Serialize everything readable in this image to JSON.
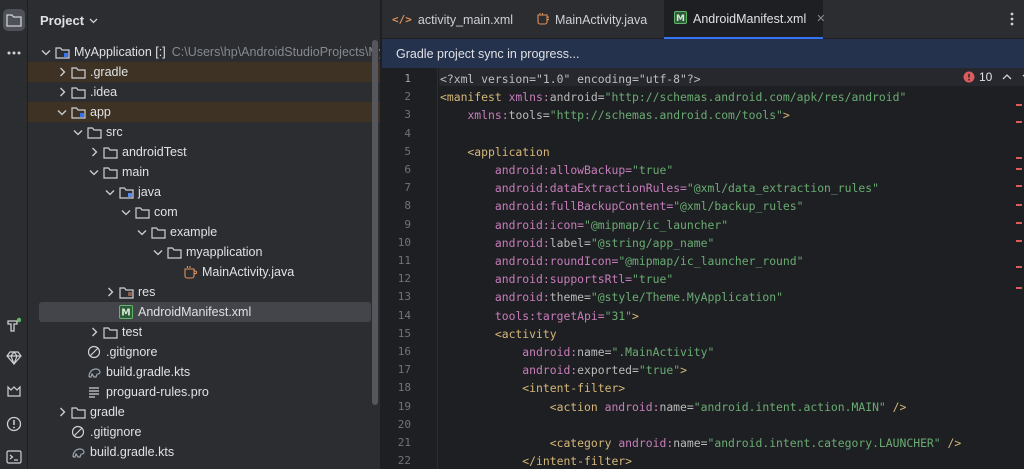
{
  "project_panel": {
    "title": "Project",
    "tree": [
      {
        "label": "MyApplication [:]",
        "hint": "C:\\Users\\hp\\AndroidStudioProjects\\MyAp",
        "depth": 0,
        "expanded": true,
        "icon": "module-folder-icon"
      },
      {
        "label": ".gradle",
        "depth": 1,
        "expanded": false,
        "icon": "folder-icon",
        "excluded": true
      },
      {
        "label": ".idea",
        "depth": 1,
        "expanded": false,
        "icon": "folder-icon"
      },
      {
        "label": "app",
        "depth": 1,
        "expanded": true,
        "icon": "module-folder-icon",
        "excluded": true
      },
      {
        "label": "src",
        "depth": 2,
        "expanded": true,
        "icon": "folder-icon"
      },
      {
        "label": "androidTest",
        "depth": 3,
        "expanded": false,
        "icon": "folder-icon"
      },
      {
        "label": "main",
        "depth": 3,
        "expanded": true,
        "icon": "folder-icon"
      },
      {
        "label": "java",
        "depth": 4,
        "expanded": true,
        "icon": "source-folder-icon"
      },
      {
        "label": "com",
        "depth": 5,
        "expanded": true,
        "icon": "package-icon"
      },
      {
        "label": "example",
        "depth": 6,
        "expanded": true,
        "icon": "package-icon"
      },
      {
        "label": "myapplication",
        "depth": 7,
        "expanded": true,
        "icon": "package-icon"
      },
      {
        "label": "MainActivity.java",
        "depth": 8,
        "icon": "java-class-icon"
      },
      {
        "label": "res",
        "depth": 4,
        "expanded": false,
        "icon": "resource-folder-icon"
      },
      {
        "label": "AndroidManifest.xml",
        "depth": 4,
        "icon": "manifest-icon",
        "selected": true
      },
      {
        "label": "test",
        "depth": 3,
        "expanded": false,
        "icon": "folder-icon"
      },
      {
        "label": ".gitignore",
        "depth": 2,
        "icon": "gitignore-icon"
      },
      {
        "label": "build.gradle.kts",
        "depth": 2,
        "icon": "gradle-file-icon"
      },
      {
        "label": "proguard-rules.pro",
        "depth": 2,
        "icon": "text-file-icon"
      },
      {
        "label": "gradle",
        "depth": 1,
        "expanded": false,
        "icon": "folder-icon"
      },
      {
        "label": ".gitignore",
        "depth": 1,
        "icon": "gitignore-icon"
      },
      {
        "label": "build.gradle.kts",
        "depth": 1,
        "icon": "gradle-file-icon"
      }
    ]
  },
  "editor": {
    "tabs": [
      {
        "label": "activity_main.xml",
        "icon": "xml-icon",
        "active": false
      },
      {
        "label": "MainActivity.java",
        "icon": "java-class-icon",
        "active": false
      },
      {
        "label": "AndroidManifest.xml",
        "icon": "manifest-icon",
        "active": true
      }
    ],
    "tab_close": "✕",
    "banner": "Gradle project sync in progress...",
    "problems_count": "10",
    "lines": [
      {
        "n": "1",
        "parts": [
          [
            "pi",
            "<?xml version=\"1.0\" encoding=\"utf-8\"?>"
          ]
        ]
      },
      {
        "n": "2",
        "parts": [
          [
            "tg",
            "<manifest "
          ],
          [
            "ns",
            "xmlns:"
          ],
          [
            "at",
            "android="
          ],
          [
            "vl",
            "\"http://schemas.android.com/apk/res/android\""
          ]
        ]
      },
      {
        "n": "3",
        "parts": [
          [
            "at",
            "    "
          ],
          [
            "ns",
            "xmlns:"
          ],
          [
            "at",
            "tools="
          ],
          [
            "vl",
            "\"http://schemas.android.com/tools\""
          ],
          [
            "tg",
            ">"
          ]
        ]
      },
      {
        "n": "4",
        "parts": []
      },
      {
        "n": "5",
        "parts": [
          [
            "tg",
            "    <application"
          ]
        ]
      },
      {
        "n": "6",
        "parts": [
          [
            "at",
            "        "
          ],
          [
            "ns",
            "android:"
          ],
          [
            "ns",
            "allowBackup="
          ],
          [
            "vl",
            "\"true\""
          ]
        ]
      },
      {
        "n": "7",
        "parts": [
          [
            "at",
            "        "
          ],
          [
            "ns",
            "android:"
          ],
          [
            "ns",
            "dataExtractionRules="
          ],
          [
            "vl",
            "\"@xml/data_extraction_rules\""
          ]
        ]
      },
      {
        "n": "8",
        "parts": [
          [
            "at",
            "        "
          ],
          [
            "ns",
            "android:"
          ],
          [
            "ns",
            "fullBackupContent="
          ],
          [
            "vl",
            "\"@xml/backup_rules\""
          ]
        ]
      },
      {
        "n": "9",
        "parts": [
          [
            "at",
            "        "
          ],
          [
            "ns",
            "android:"
          ],
          [
            "ns",
            "icon="
          ],
          [
            "vl",
            "\"@mipmap/ic_launcher\""
          ]
        ]
      },
      {
        "n": "10",
        "parts": [
          [
            "at",
            "        "
          ],
          [
            "ns",
            "android:"
          ],
          [
            "at",
            "label="
          ],
          [
            "vl",
            "\"@string/app_name\""
          ]
        ]
      },
      {
        "n": "11",
        "parts": [
          [
            "at",
            "        "
          ],
          [
            "ns",
            "android:"
          ],
          [
            "ns",
            "roundIcon="
          ],
          [
            "vl",
            "\"@mipmap/ic_launcher_round\""
          ]
        ]
      },
      {
        "n": "12",
        "parts": [
          [
            "at",
            "        "
          ],
          [
            "ns",
            "android:"
          ],
          [
            "ns",
            "supportsRtl="
          ],
          [
            "vl",
            "\"true\""
          ]
        ]
      },
      {
        "n": "13",
        "parts": [
          [
            "at",
            "        "
          ],
          [
            "ns",
            "android:"
          ],
          [
            "at",
            "theme="
          ],
          [
            "vl",
            "\"@style/Theme.MyApplication\""
          ]
        ]
      },
      {
        "n": "14",
        "parts": [
          [
            "at",
            "        "
          ],
          [
            "ns",
            "tools:"
          ],
          [
            "ns",
            "targetApi="
          ],
          [
            "vl",
            "\"31\""
          ],
          [
            "tg",
            ">"
          ]
        ]
      },
      {
        "n": "15",
        "parts": [
          [
            "tg",
            "        <activity"
          ]
        ]
      },
      {
        "n": "16",
        "parts": [
          [
            "at",
            "            "
          ],
          [
            "ns",
            "android:"
          ],
          [
            "at",
            "name="
          ],
          [
            "vl",
            "\".MainActivity\""
          ]
        ]
      },
      {
        "n": "17",
        "parts": [
          [
            "at",
            "            "
          ],
          [
            "ns",
            "android:"
          ],
          [
            "at",
            "exported="
          ],
          [
            "vl",
            "\"true\""
          ],
          [
            "tg",
            ">"
          ]
        ]
      },
      {
        "n": "18",
        "parts": [
          [
            "tg",
            "            <intent-filter>"
          ]
        ]
      },
      {
        "n": "19",
        "parts": [
          [
            "tg",
            "                <action "
          ],
          [
            "ns",
            "android:"
          ],
          [
            "at",
            "name="
          ],
          [
            "vl",
            "\"android.intent.action.MAIN\""
          ],
          [
            "tg",
            " />"
          ]
        ]
      },
      {
        "n": "20",
        "parts": []
      },
      {
        "n": "21",
        "parts": [
          [
            "tg",
            "                <category "
          ],
          [
            "ns",
            "android:"
          ],
          [
            "at",
            "name="
          ],
          [
            "vl",
            "\"android.intent.category.LAUNCHER\""
          ],
          [
            "tg",
            " />"
          ]
        ]
      },
      {
        "n": "22",
        "parts": [
          [
            "tg",
            "            </intent-filter>"
          ]
        ]
      }
    ]
  },
  "tool_strip": [
    "project-icon",
    "more-icon",
    "build-variants-icon",
    "gemini-icon",
    "device-manager-icon",
    "problems-icon",
    "terminal-icon"
  ],
  "colors": {
    "accent": "#3574f0",
    "tag": "#d5b778",
    "attr_ns": "#c77dbb",
    "string": "#6aab73",
    "error": "#db5c5c"
  }
}
